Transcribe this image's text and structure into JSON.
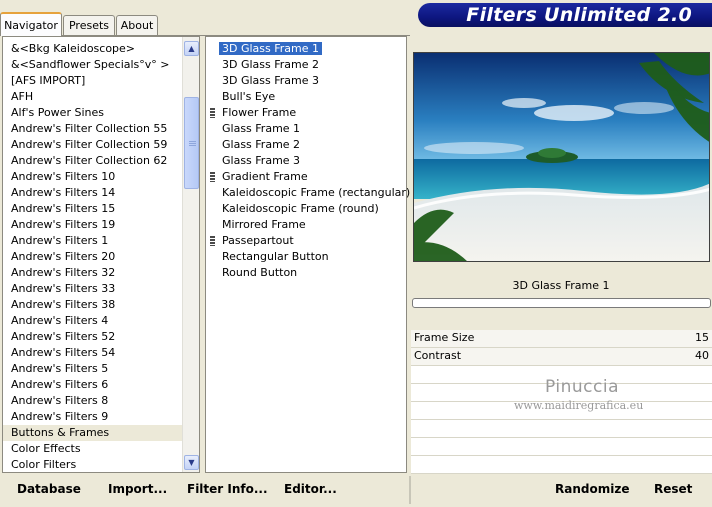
{
  "tabs": [
    {
      "label": "Navigator",
      "active": true
    },
    {
      "label": "Presets",
      "active": false
    },
    {
      "label": "About",
      "active": false
    }
  ],
  "banner": {
    "title": "Filters Unlimited 2.0"
  },
  "categories": {
    "items": [
      "&<Bkg Kaleidoscope>",
      "&<Sandflower Specials°v° >",
      "[AFS IMPORT]",
      "AFH",
      "Alf's Power Sines",
      "Andrew's Filter Collection 55",
      "Andrew's Filter Collection 59",
      "Andrew's Filter Collection 62",
      "Andrew's Filters 10",
      "Andrew's Filters 14",
      "Andrew's Filters 15",
      "Andrew's Filters 19",
      "Andrew's Filters 1",
      "Andrew's Filters 20",
      "Andrew's Filters 32",
      "Andrew's Filters 33",
      "Andrew's Filters 38",
      "Andrew's Filters 4",
      "Andrew's Filters 52",
      "Andrew's Filters 54",
      "Andrew's Filters 5",
      "Andrew's Filters 6",
      "Andrew's Filters 8",
      "Andrew's Filters 9",
      "Buttons & Frames",
      "Color Effects",
      "Color Filters"
    ],
    "selected": "Buttons & Frames"
  },
  "filters": {
    "items": [
      {
        "label": "3D Glass Frame 1",
        "marked": false,
        "selected": true
      },
      {
        "label": "3D Glass Frame 2",
        "marked": false,
        "selected": false
      },
      {
        "label": "3D Glass Frame 3",
        "marked": false,
        "selected": false
      },
      {
        "label": "Bull's Eye",
        "marked": false,
        "selected": false
      },
      {
        "label": "Flower Frame",
        "marked": true,
        "selected": false
      },
      {
        "label": "Glass Frame 1",
        "marked": false,
        "selected": false
      },
      {
        "label": "Glass Frame 2",
        "marked": false,
        "selected": false
      },
      {
        "label": "Glass Frame 3",
        "marked": false,
        "selected": false
      },
      {
        "label": "Gradient Frame",
        "marked": true,
        "selected": false
      },
      {
        "label": "Kaleidoscopic Frame (rectangular)",
        "marked": false,
        "selected": false
      },
      {
        "label": "Kaleidoscopic Frame (round)",
        "marked": false,
        "selected": false
      },
      {
        "label": "Mirrored Frame",
        "marked": false,
        "selected": false
      },
      {
        "label": "Passepartout",
        "marked": true,
        "selected": false
      },
      {
        "label": "Rectangular Button",
        "marked": false,
        "selected": false
      },
      {
        "label": "Round Button",
        "marked": false,
        "selected": false
      }
    ]
  },
  "preview": {
    "filter_name": "3D Glass Frame 1",
    "progress": 0
  },
  "params": [
    {
      "label": "Frame Size",
      "value": "15"
    },
    {
      "label": "Contrast",
      "value": "40"
    }
  ],
  "watermark": {
    "name": "Pinuccia",
    "url": "www.maidiregrafica.eu"
  },
  "buttons": {
    "database": "Database",
    "import": "Import...",
    "filter_info": "Filter Info...",
    "editor": "Editor...",
    "randomize": "Randomize",
    "reset": "Reset"
  },
  "colors": {
    "selection": "#316ac5",
    "banner": "#0d1680",
    "background": "#ece9d8"
  }
}
